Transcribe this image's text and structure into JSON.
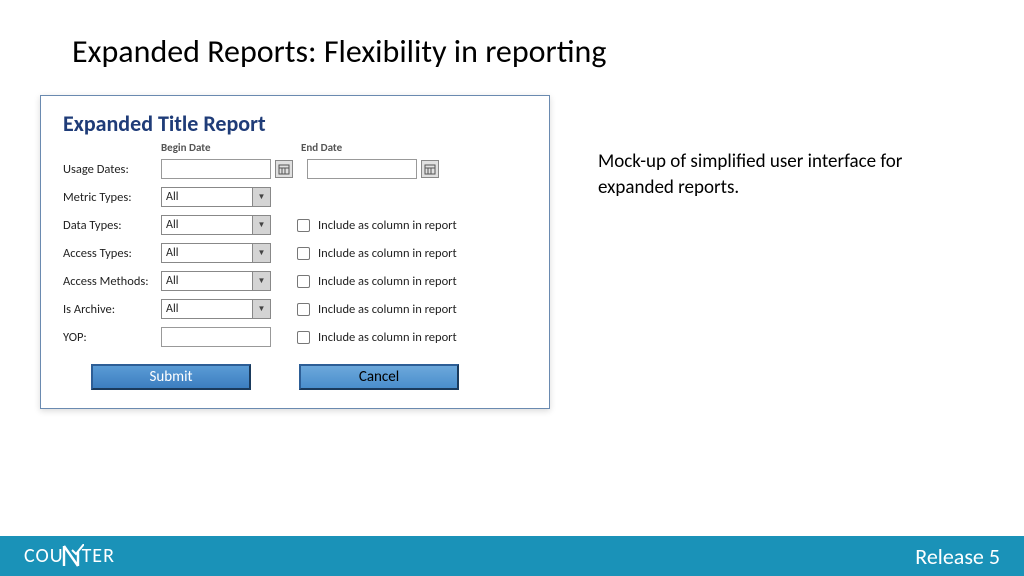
{
  "page_title": "Expanded Reports: Flexibility in reporting",
  "panel": {
    "title": "Expanded Title Report",
    "begin_date_label": "Begin Date",
    "end_date_label": "End Date",
    "rows": {
      "usage_dates": "Usage Dates:",
      "metric_types": "Metric Types:",
      "data_types": "Data Types:",
      "access_types": "Access Types:",
      "access_methods": "Access Methods:",
      "is_archive": "Is Archive:",
      "yop": "YOP:"
    },
    "select_value": "All",
    "include_label": "Include as column in report",
    "submit": "Submit",
    "cancel": "Cancel"
  },
  "description": "Mock-up of simplified user interface for expanded reports.",
  "footer": {
    "logo_left": "COU",
    "logo_right": "TER",
    "release": "Release 5"
  }
}
